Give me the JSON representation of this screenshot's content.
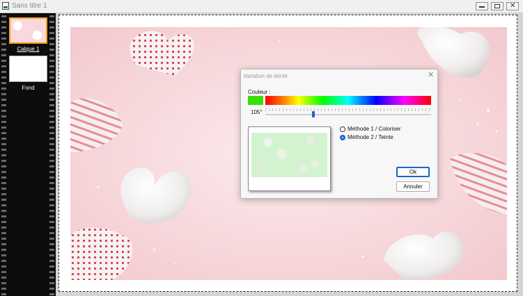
{
  "window": {
    "title": "Sans titre 1",
    "controls": {
      "minimize_icon": "minimize-icon",
      "maximize_icon": "maximize-icon",
      "close_icon": "close-icon"
    }
  },
  "layers": [
    {
      "label": "Calque 1",
      "selected": true
    },
    {
      "label": "Fond",
      "selected": false
    }
  ],
  "dialog": {
    "title": "Variation de teinte",
    "close_glyph": "✕",
    "color_label": "Couleur :",
    "swatch_color": "#38e000",
    "hue_value": "105°",
    "hue_fraction": 0.29,
    "options": [
      {
        "label": "Méthode 1 / Coloriser",
        "selected": false
      },
      {
        "label": "Méthode 2 / Teinte",
        "selected": true
      }
    ],
    "ok_label": "Ok",
    "cancel_label": "Annuler"
  },
  "colors": {
    "accent": "#1a66c8",
    "canvas_background": "#f7d8db",
    "preview_tint": "#d3f3d0"
  }
}
